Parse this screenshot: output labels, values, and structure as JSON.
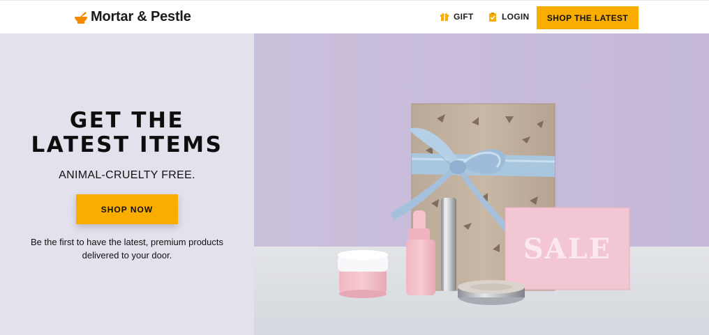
{
  "header": {
    "brand": "Mortar & Pestle",
    "brand_icon": "mortar-pestle-icon",
    "nav": [
      {
        "label": "GIFT",
        "icon": "gift-icon"
      },
      {
        "label": "LOGIN",
        "icon": "clipboard-check-icon"
      }
    ],
    "cta_label": "SHOP THE LATEST"
  },
  "hero": {
    "title_line1": "GET THE",
    "title_line2": "LATEST ITEMS",
    "subtitle": "ANIMAL-CRUELTY FREE.",
    "button_label": "SHOP NOW",
    "desc_line1": "Be the first to have the latest, premium products",
    "desc_line2": "delivered to your door.",
    "image": {
      "sign_text": "SALE"
    }
  },
  "colors": {
    "accent": "#f8ad00",
    "hero_left_bg": "#e3e1ec",
    "image_wall": "#c9bddb",
    "image_table": "#dfe1e6"
  }
}
